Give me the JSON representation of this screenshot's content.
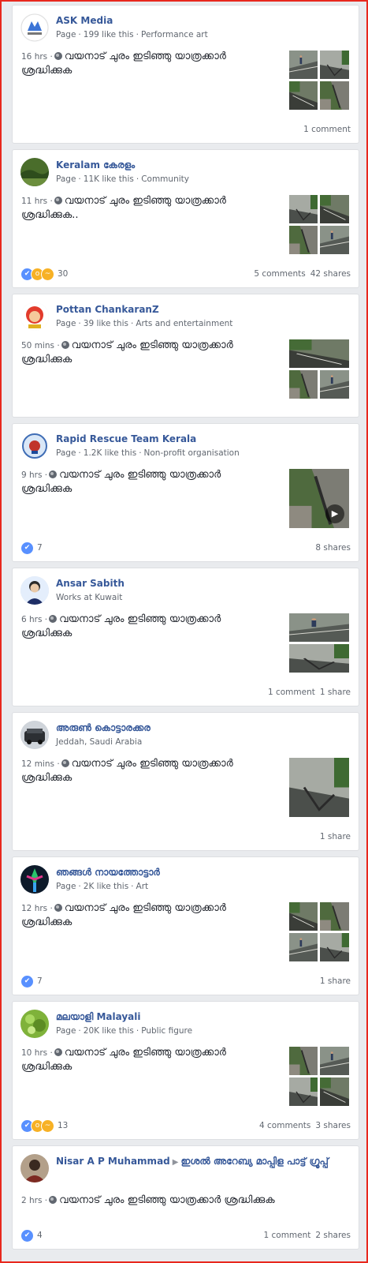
{
  "posts": [
    {
      "author": "ASK Media",
      "group": "",
      "meta": [
        "Page",
        "199 like this",
        "Performance art"
      ],
      "time": "16 hrs",
      "text": "വയനാട് ചുരം ഇടിഞ്ഞു യാത്രക്കാർ ശ്രദ്ധിക്കുക",
      "reactions": [],
      "reaction_count": "",
      "comments": "1 comment",
      "shares": ""
    },
    {
      "author": "Keralam കേരളം",
      "group": "",
      "meta": [
        "Page",
        "11K like this",
        "Community"
      ],
      "time": "11 hrs",
      "text": "വയനാട് ചുരം ഇടിഞ്ഞു യാത്രക്കാർ ശ്രദ്ധിക്കുക..",
      "reactions": [
        "like",
        "wow",
        "sad"
      ],
      "reaction_count": "30",
      "comments": "5 comments",
      "shares": "42 shares"
    },
    {
      "author": "Pottan ChankaranZ",
      "group": "",
      "meta": [
        "Page",
        "39 like this",
        "Arts and entertainment"
      ],
      "time": "50 mins",
      "text": "വയനാട് ചുരം ഇടിഞ്ഞു യാത്രക്കാർ ശ്രദ്ധിക്കുക",
      "reactions": [],
      "reaction_count": "",
      "comments": "",
      "shares": ""
    },
    {
      "author": "Rapid Rescue Team Kerala",
      "group": "",
      "meta": [
        "Page",
        "1.2K like this",
        "Non-profit organisation"
      ],
      "time": "9 hrs",
      "text": "വയനാട് ചുരം ഇടിഞ്ഞു യാത്രക്കാർ ശ്രദ്ധിക്കുക",
      "reactions": [
        "like"
      ],
      "reaction_count": "7",
      "comments": "",
      "shares": "8 shares"
    },
    {
      "author": "Ansar Sabith",
      "group": "",
      "meta": [
        "Works at Kuwait"
      ],
      "time": "6 hrs",
      "text": "വയനാട് ചുരം ഇടിഞ്ഞു യാത്രക്കാർ ശ്രദ്ധിക്കുക",
      "reactions": [],
      "reaction_count": "",
      "comments": "1 comment",
      "shares": "1 share"
    },
    {
      "author": "അരുൺ കൊട്ടാരക്കര",
      "group": "",
      "meta": [
        "Jeddah, Saudi Arabia"
      ],
      "time": "12 mins",
      "text": "വയനാട് ചുരം ഇടിഞ്ഞു യാത്രക്കാർ ശ്രദ്ധിക്കുക",
      "reactions": [],
      "reaction_count": "",
      "comments": "",
      "shares": "1 share"
    },
    {
      "author": "ഞങ്ങൾ നായത്തോട്ടാർ",
      "group": "",
      "meta": [
        "Page",
        "2K like this",
        "Art"
      ],
      "time": "12 hrs",
      "text": "വയനാട് ചുരം ഇടിഞ്ഞു യാത്രക്കാർ ശ്രദ്ധിക്കുക",
      "reactions": [
        "like"
      ],
      "reaction_count": "7",
      "comments": "",
      "shares": "1 share"
    },
    {
      "author": "മലയാളി Malayali",
      "group": "",
      "meta": [
        "Page",
        "20K like this",
        "Public figure"
      ],
      "time": "10 hrs",
      "text": "വയനാട് ചുരം ഇടിഞ്ഞു യാത്രക്കാർ ശ്രദ്ധിക്കുക",
      "reactions": [
        "like",
        "wow",
        "sad"
      ],
      "reaction_count": "13",
      "comments": "4 comments",
      "shares": "3 shares"
    },
    {
      "author": "Nisar A P Muhammad",
      "group": "ഇശൽ അറേബ്യ മാപ്പിള പാട്ട് ഗ്രൂപ്പ്",
      "meta": [],
      "time": "2 hrs",
      "text": "വയനാട് ചുരം ഇടിഞ്ഞു യാത്രക്കാർ ശ്രദ്ധിക്കുക",
      "reactions": [
        "like"
      ],
      "reaction_count": "4",
      "comments": "1 comment",
      "shares": "2 shares"
    }
  ],
  "colors": {
    "link": "#365899",
    "meta": "#616770",
    "border_accent": "#e8281d",
    "like": "#5890ff",
    "wow_sad": "#f7b125"
  }
}
